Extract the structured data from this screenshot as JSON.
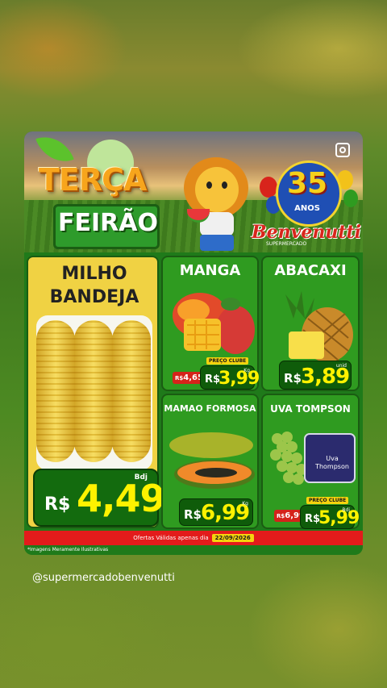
{
  "header": {
    "title_line1": "TERÇA",
    "title_line2": "FEIRÃO",
    "anniversary_number": "35",
    "anniversary_word": "ANOS",
    "brand": "Benvenutti",
    "brand_sub": "SUPERMERCADO"
  },
  "products": {
    "milho": {
      "name": "MILHO BANDEJA",
      "currency": "R$",
      "price": "4,49",
      "unit": "Bdj"
    },
    "manga": {
      "name": "MANGA",
      "club_label": "PREÇO CLUBE",
      "old_currency": "R$",
      "old_price": "4,65",
      "currency": "R$",
      "price": "3,99",
      "unit": "Kg"
    },
    "abacaxi": {
      "name": "ABACAXI",
      "currency": "R$",
      "price": "3,89",
      "unit": "unid"
    },
    "mamao": {
      "name": "MAMAO FORMOSA",
      "currency": "R$",
      "price": "6,99",
      "unit": "Kg"
    },
    "uva": {
      "name": "UVA TOMPSON",
      "package_label": "Uva Thompson",
      "club_label": "PREÇO CLUBE",
      "old_currency": "R$",
      "old_price": "6,99",
      "currency": "R$",
      "price": "5,99",
      "unit": "Bdj"
    }
  },
  "footer": {
    "validity_text": "Ofertas Válidas apenas dia",
    "date": "22/09/2026",
    "note": "*Imagens Meramente Ilustrativas"
  },
  "account_handle": "@supermercadobenvenutti",
  "colors": {
    "green_panel": "#2f9b20",
    "price_yellow": "#fff200",
    "red_bar": "#e31b1b",
    "milho_bg": "#f0d243"
  }
}
